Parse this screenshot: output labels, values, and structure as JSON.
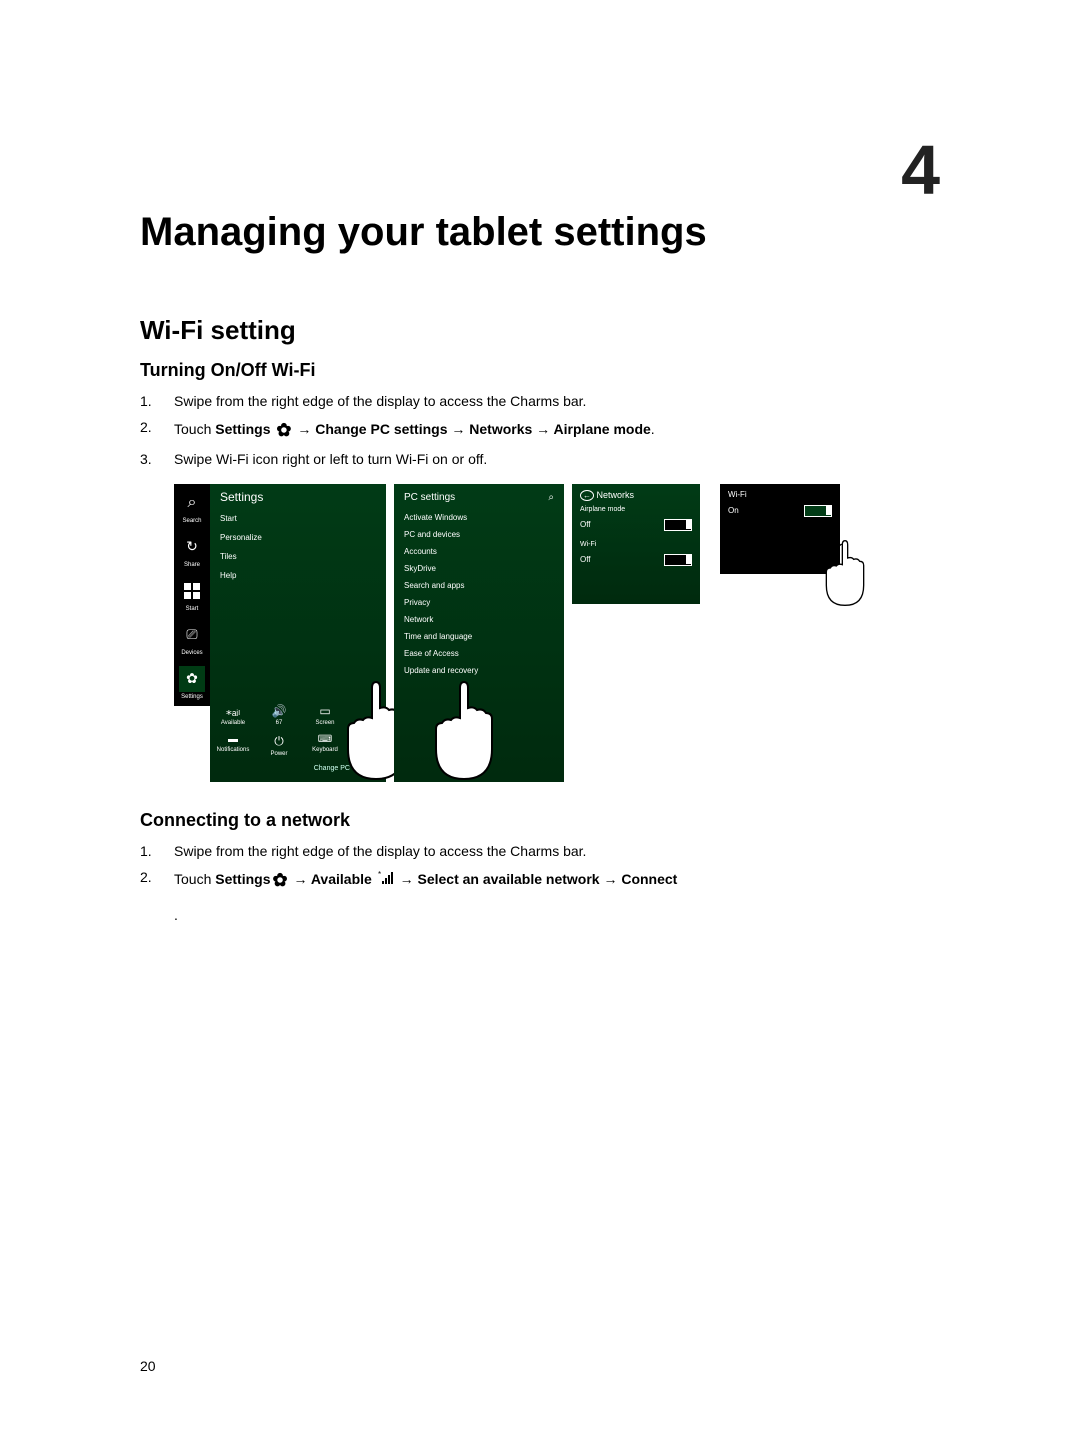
{
  "chapter_number": "4",
  "title": "Managing your tablet settings",
  "section1": "Wi-Fi setting",
  "sub1": "Turning On/Off Wi-Fi",
  "steps1": {
    "s1": "Swipe from the right edge of the display to access the Charms bar.",
    "s2_pre": "Touch ",
    "s2_settings": "Settings",
    "s2_path": " → Change PC settings → Networks → Airplane mode",
    "s2_post": ".",
    "s3": "Swipe Wi-Fi icon right or left to turn Wi-Fi on or off."
  },
  "sub2": "Connecting to a network",
  "steps2": {
    "s1": "Swipe from the right edge of the display to access the Charms bar.",
    "s2_touch": "Touch ",
    "s2_settings": "Settings",
    "s2_arrow1": " → ",
    "s2_available": "Available",
    "s2_arrow2": " → ",
    "s2_rest": "Select an available network → Connect"
  },
  "page_number": "20",
  "fig": {
    "charms": {
      "search": "Search",
      "share": "Share",
      "start": "Start",
      "devices": "Devices",
      "settings": "Settings"
    },
    "settings_panel": {
      "title": "Settings",
      "start": "Start",
      "personalize": "Personalize",
      "tiles": "Tiles",
      "help": "Help",
      "quick": {
        "network": "Available",
        "volume": "67",
        "screen": "Screen",
        "notifications": "Notifications",
        "power": "Power",
        "keyboard": "Keyboard"
      },
      "change": "Change PC settings"
    },
    "pc_settings": {
      "title": "PC settings",
      "items": {
        "activate": "Activate Windows",
        "pcdev": "PC and devices",
        "accounts": "Accounts",
        "skydrive": "SkyDrive",
        "search": "Search and apps",
        "privacy": "Privacy",
        "network": "Network",
        "time": "Time and language",
        "ease": "Ease of Access",
        "update": "Update and recovery"
      }
    },
    "networks": {
      "title": "Networks",
      "airplane": "Airplane mode",
      "off": "Off",
      "wifi": "Wi-Fi",
      "wifi_off": "Off"
    },
    "wifi_close": {
      "label": "Wi-Fi",
      "on": "On"
    }
  }
}
